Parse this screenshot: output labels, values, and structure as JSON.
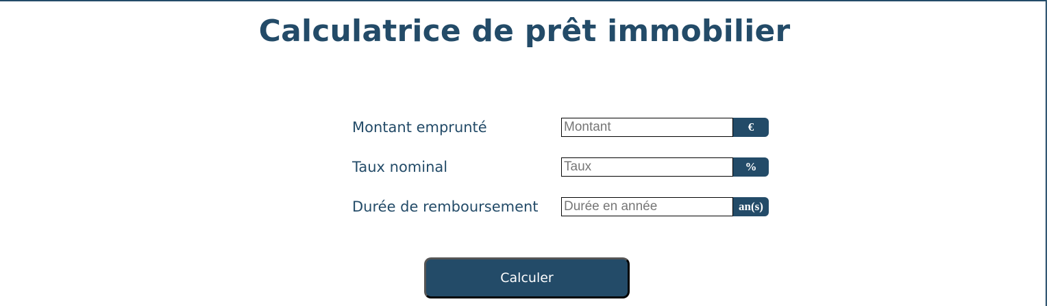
{
  "page": {
    "title": "Calculatrice de prêt immobilier"
  },
  "form": {
    "fields": [
      {
        "label": "Montant emprunté",
        "placeholder": "Montant",
        "value": "",
        "unit": "€"
      },
      {
        "label": "Taux nominal",
        "placeholder": "Taux",
        "value": "",
        "unit": "%"
      },
      {
        "label": "Durée de remboursement",
        "placeholder": "Durée en année",
        "value": "",
        "unit": "an(s)"
      }
    ],
    "submit_label": "Calculer"
  },
  "colors": {
    "primary": "#234B68",
    "background": "#FFFFFF",
    "input_border": "#000000",
    "placeholder": "#767676"
  }
}
